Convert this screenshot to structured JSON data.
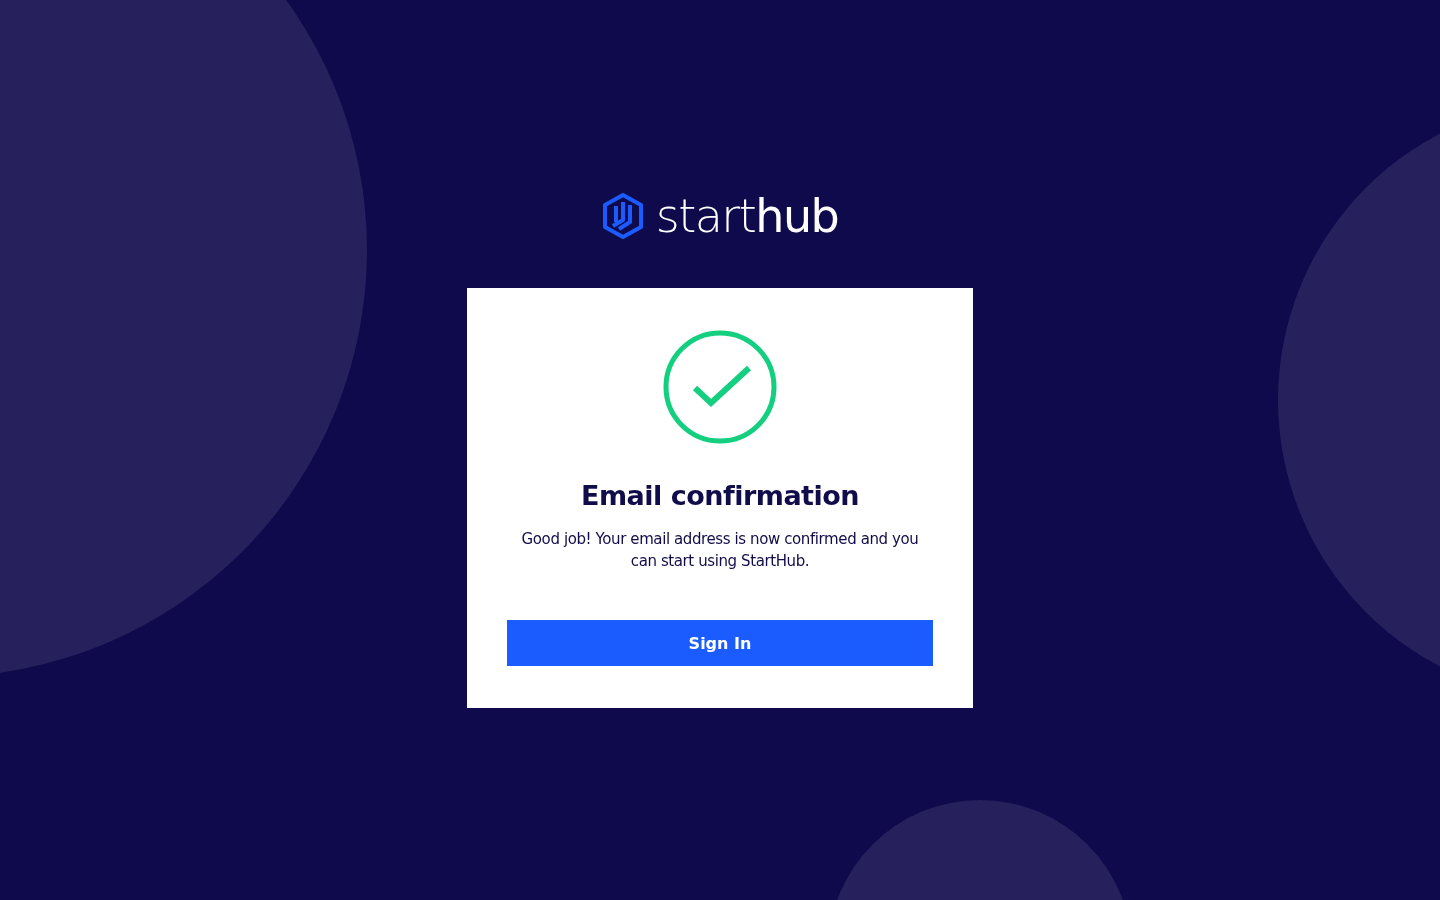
{
  "logo": {
    "text": "start**hub**"
  },
  "card": {
    "title": "Email confirmation",
    "message": "Good job! Your email address is now confirmed and you can start using StartHub.",
    "button": "Sign In"
  }
}
